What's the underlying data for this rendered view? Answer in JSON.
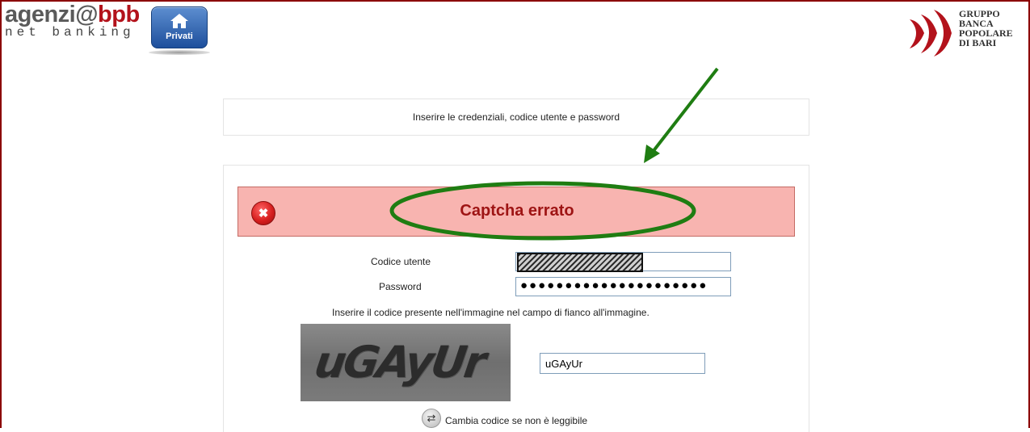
{
  "header": {
    "logo_part1": "agenzi@",
    "logo_part2": "bpb",
    "logo_sub": "net banking",
    "privati_label": "Privati",
    "bank_name_lines": [
      "GRUPPO",
      "BANCA",
      "POPOLARE",
      "DI BARI"
    ]
  },
  "login": {
    "instruction": "Inserire le credenziali, codice utente e password",
    "error_message": "Captcha errato",
    "user_code_label": "Codice utente",
    "password_label": "Password",
    "password_mask": "●●●●●●●●●●●●●●●●●●●●●",
    "captcha_instruction": "Inserire il codice presente nell'immagine nel campo di fianco all'immagine.",
    "captcha_image_text": "uGAyUr",
    "captcha_value": "uGAyUr",
    "change_code_label": "Cambia codice se non è leggibile"
  },
  "colors": {
    "brand_red": "#b3121b",
    "error_bg": "#f8b4b0",
    "annotation_green": "#1f7d12"
  },
  "icons": [
    "home-icon",
    "bank-logo-mark",
    "error-close-icon",
    "refresh-icon"
  ]
}
